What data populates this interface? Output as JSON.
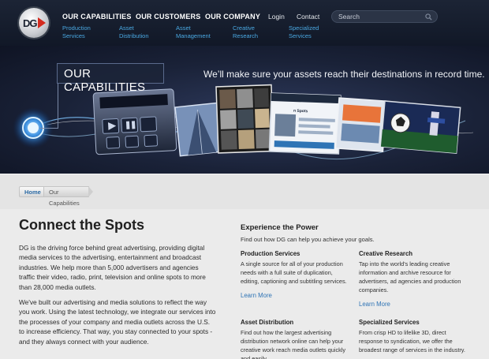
{
  "header": {
    "logo_text": "DG",
    "nav_main": [
      "OUR CAPABILITIES",
      "OUR CUSTOMERS",
      "OUR COMPANY"
    ],
    "nav_util": [
      "Login",
      "Contact"
    ],
    "search_placeholder": "Search",
    "subnav": [
      "Production Services",
      "Asset Distribution",
      "Asset Management",
      "Creative Research",
      "Specialized Services"
    ]
  },
  "hero": {
    "title": "OUR CAPABILITIES",
    "tagline": "We’ll make sure your assets reach their destinations in record time.",
    "screen_text": "n Spots"
  },
  "breadcrumb": {
    "home": "Home",
    "current": "Our Capabilities"
  },
  "content": {
    "title": "Connect the Spots",
    "paragraphs": [
      "DG is the driving force behind great advertising, providing digital media services to the advertising, entertainment and broadcast industries. We help more than 5,000 advertisers and agencies traffic their video, radio, print, television and online spots to more than 28,000 media outlets.",
      "We've built our advertising and media solutions to reflect the way you work. Using the latest technology, we integrate our services into the processes of your company and media outlets across the U.S. to increase efficiency. That way, you stay connected to your spots - and they always connect with your audience."
    ]
  },
  "sidebar": {
    "title": "Experience the Power",
    "subtitle": "Find out how DG can help you achieve your goals.",
    "services": [
      {
        "title": "Production Services",
        "desc": "A single source for all of your production needs with a full suite of duplication, editing, captioning and subtitling services.",
        "link": "Learn More"
      },
      {
        "title": "Creative Research",
        "desc": "Tap into the world's leading creative information and archive resource for advertisers, ad agencies and production companies.",
        "link": "Learn More"
      },
      {
        "title": "Asset Distribution",
        "desc": "Find out how the largest advertising distribution network online can help your creative work reach media outlets quickly and easily.",
        "link": ""
      },
      {
        "title": "Specialized Services",
        "desc": "From crisp HD to lifelike 3D, direct response to syndication, we offer the broadest range of services in the industry.",
        "link": ""
      }
    ]
  },
  "colors": {
    "header_bg": "#161d2c",
    "subnav_link": "#4aa9e3",
    "link": "#2f74b5",
    "logo_accent": "#d42b1f"
  }
}
